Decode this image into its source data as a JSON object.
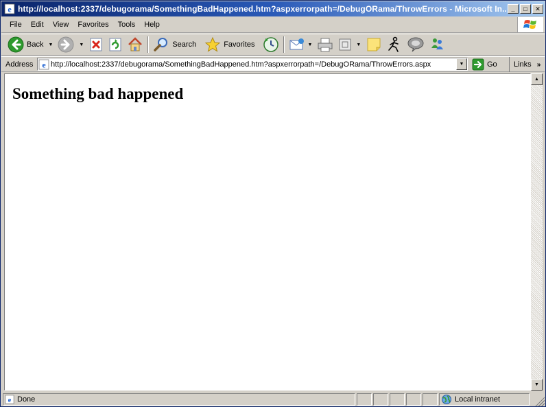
{
  "window": {
    "title": "http://localhost:2337/debugorama/SomethingBadHappened.htm?aspxerrorpath=/DebugORama/ThrowErrors - Microsoft In...",
    "minimize": "_",
    "maximize": "□",
    "close": "✕"
  },
  "menu": {
    "items": [
      {
        "label": "File"
      },
      {
        "label": "Edit"
      },
      {
        "label": "View"
      },
      {
        "label": "Favorites"
      },
      {
        "label": "Tools"
      },
      {
        "label": "Help"
      }
    ]
  },
  "toolbar": {
    "back_label": "Back",
    "search_label": "Search",
    "favorites_label": "Favorites"
  },
  "address": {
    "label": "Address",
    "url": "http://localhost:2337/debugorama/SomethingBadHappened.htm?aspxerrorpath=/DebugORama/ThrowErrors.aspx",
    "go_label": "Go",
    "links_label": "Links"
  },
  "page": {
    "heading": "Something bad happened"
  },
  "status": {
    "text": "Done",
    "zone": "Local intranet"
  },
  "colors": {
    "titlebar_start": "#0a246a",
    "titlebar_end": "#a6caf0",
    "chrome": "#d4d0c8"
  }
}
